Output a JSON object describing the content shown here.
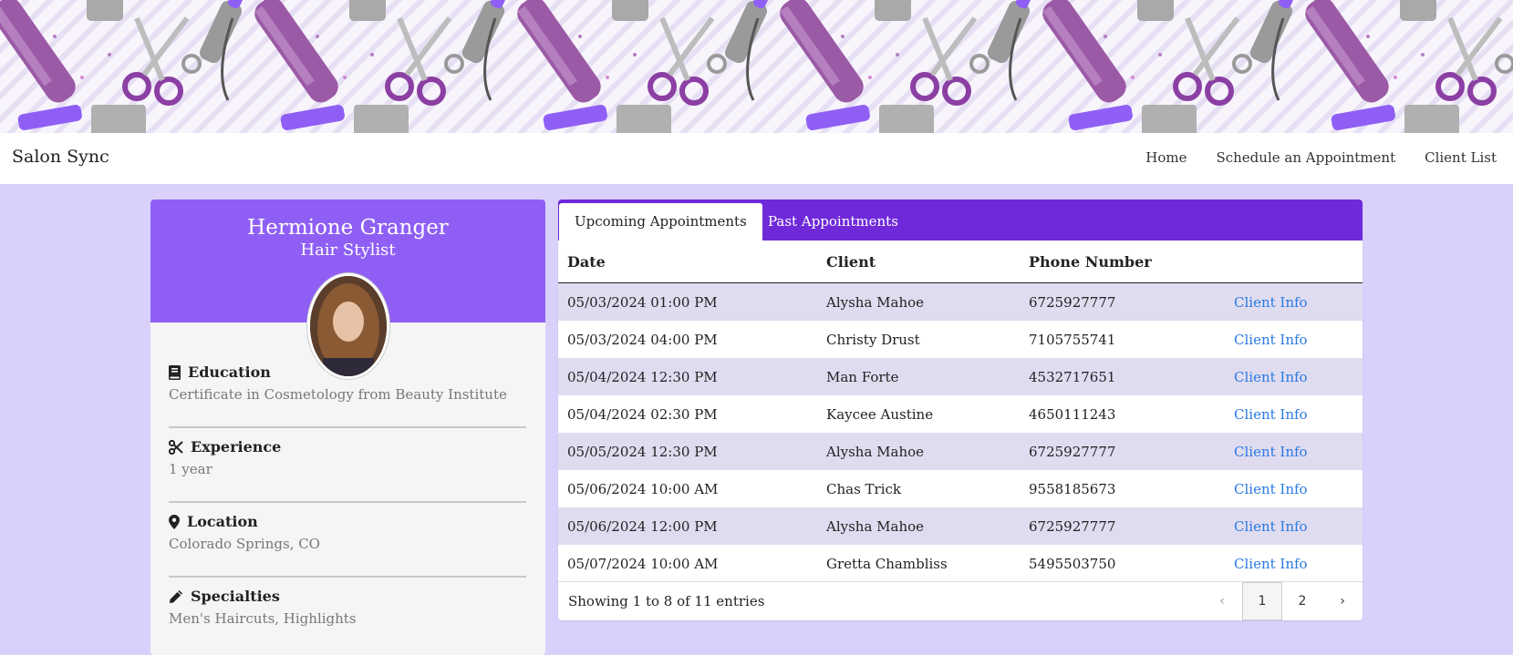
{
  "app": {
    "brand": "Salon Sync"
  },
  "nav": [
    {
      "label": "Home"
    },
    {
      "label": "Schedule an Appointment"
    },
    {
      "label": "Client List"
    }
  ],
  "profile": {
    "name": "Hermione Granger",
    "role": "Hair Stylist",
    "sections": [
      {
        "title": "Education",
        "icon": "book-icon",
        "value": "Certificate in Cosmetology from Beauty Institute"
      },
      {
        "title": "Experience",
        "icon": "scissors-icon",
        "value": "1 year"
      },
      {
        "title": "Location",
        "icon": "map-pin-icon",
        "value": "Colorado Springs, CO"
      },
      {
        "title": "Specialties",
        "icon": "pencil-icon",
        "value": "Men's Haircuts, Highlights"
      }
    ]
  },
  "appointments": {
    "tabs": [
      {
        "label": "Upcoming Appointments",
        "active": true
      },
      {
        "label": "Past Appointments",
        "active": false
      }
    ],
    "columns": [
      "Date",
      "Client",
      "Phone Number",
      ""
    ],
    "rows": [
      {
        "date": "05/03/2024 01:00 PM",
        "client": "Alysha Mahoe",
        "phone": "6725927777",
        "link": "Client Info"
      },
      {
        "date": "05/03/2024 04:00 PM",
        "client": "Christy Drust",
        "phone": "7105755741",
        "link": "Client Info"
      },
      {
        "date": "05/04/2024 12:30 PM",
        "client": "Man Forte",
        "phone": "4532717651",
        "link": "Client Info"
      },
      {
        "date": "05/04/2024 02:30 PM",
        "client": "Kaycee Austine",
        "phone": "4650111243",
        "link": "Client Info"
      },
      {
        "date": "05/05/2024 12:30 PM",
        "client": "Alysha Mahoe",
        "phone": "6725927777",
        "link": "Client Info"
      },
      {
        "date": "05/06/2024 10:00 AM",
        "client": "Chas Trick",
        "phone": "9558185673",
        "link": "Client Info"
      },
      {
        "date": "05/06/2024 12:00 PM",
        "client": "Alysha Mahoe",
        "phone": "6725927777",
        "link": "Client Info"
      },
      {
        "date": "05/07/2024 10:00 AM",
        "client": "Gretta Chambliss",
        "phone": "5495503750",
        "link": "Client Info"
      }
    ],
    "footer": {
      "showing": "Showing 1 to 8 of 11 entries",
      "prev": "‹",
      "pages": [
        "1",
        "2"
      ],
      "next": "›"
    }
  },
  "colors": {
    "page_bg": "#d9d1fc",
    "profile_header": "#8f5ff5",
    "tabs_bar": "#6f29d9",
    "row_stripe": "#e0dcf0",
    "link": "#2a7ae2"
  }
}
